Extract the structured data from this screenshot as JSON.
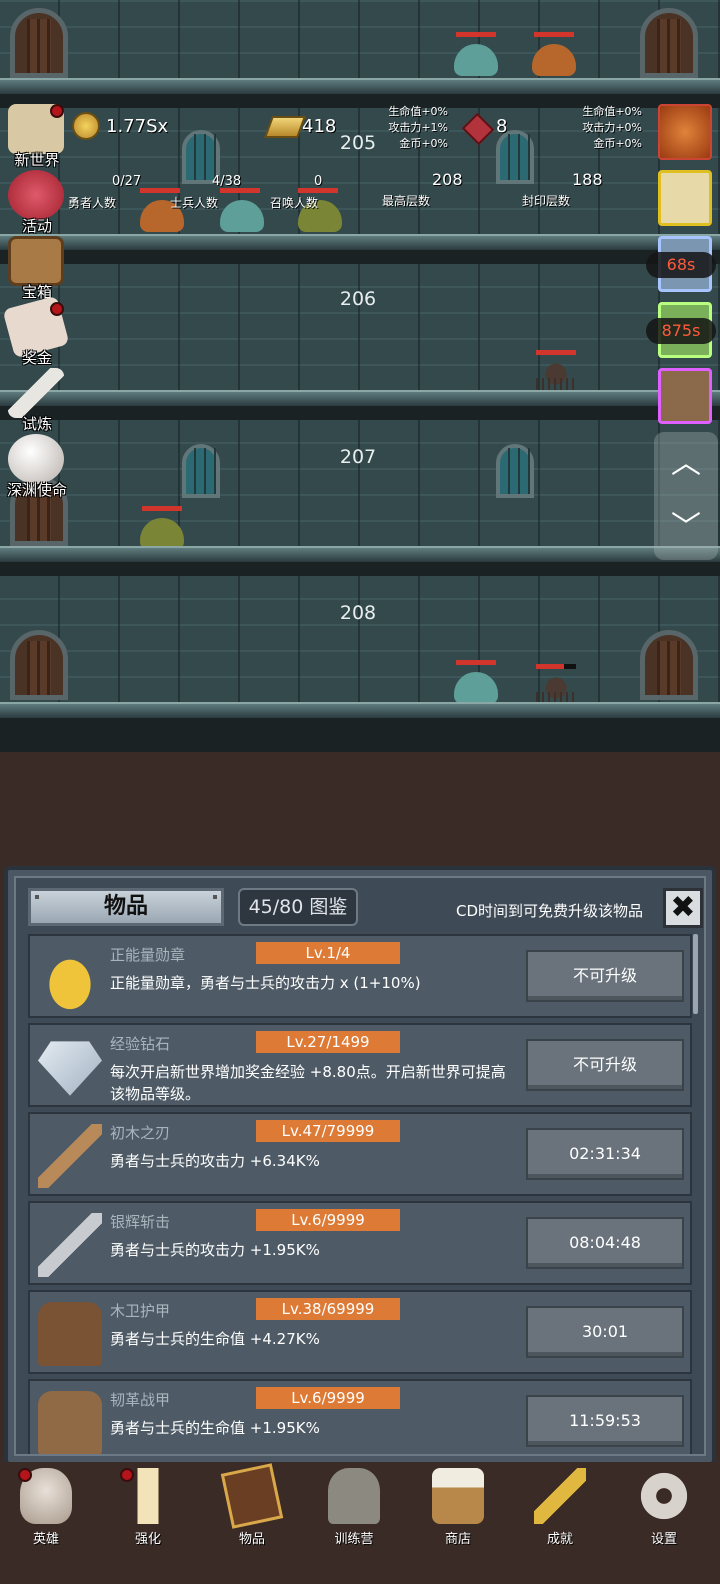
{
  "scene": {
    "floors": [
      "205",
      "206",
      "207",
      "208"
    ]
  },
  "left_menu": [
    {
      "label": "新世界",
      "badge": true
    },
    {
      "label": "活动",
      "badge": false
    },
    {
      "label": "宝箱",
      "badge": false
    },
    {
      "label": "奖金",
      "badge": true
    },
    {
      "label": "试炼",
      "badge": false
    },
    {
      "label": "深渊使命",
      "badge": false
    }
  ],
  "resources": {
    "gold": "1.77Sx",
    "bars": "418",
    "gems": "8",
    "heroes": "0/27",
    "heroes_label": "勇者人数",
    "soldiers": "4/38",
    "soldiers_label": "士兵人数",
    "summons": "0",
    "summons_label": "召唤人数",
    "max_floor": "208",
    "max_floor_label": "最高层数",
    "sealed_floor": "188",
    "sealed_floor_label": "封印层数"
  },
  "buffs_a": {
    "hp": "生命值+0%",
    "atk": "攻击力+1%",
    "gold": "金币+0%"
  },
  "buffs_b": {
    "hp": "生命值+0%",
    "atk": "攻击力+0%",
    "gold": "金币+0%"
  },
  "right_timers": {
    "t1": "68s",
    "t2": "875s"
  },
  "scroll": {
    "up": "︿",
    "down": "﹀"
  },
  "panel": {
    "tab": "物品",
    "count": "45/80 图鉴",
    "cd_note": "CD时间到可免费升级该物品",
    "close": "✖",
    "items": [
      {
        "name": "正能量勋章",
        "level": "Lv.1/4",
        "desc": "正能量勋章，勇者与士兵的攻击力 x (1+10%)",
        "action": "不可升级"
      },
      {
        "name": "经验钻石",
        "level": "Lv.27/1499",
        "desc": "每次开启新世界增加奖金经验 +8.80点。开启新世界可提高该物品等级。",
        "action": "不可升级"
      },
      {
        "name": "初木之刃",
        "level": "Lv.47/79999",
        "desc": "勇者与士兵的攻击力 +6.34K%",
        "action": "02:31:34"
      },
      {
        "name": "银辉斩击",
        "level": "Lv.6/9999",
        "desc": "勇者与士兵的攻击力 +1.95K%",
        "action": "08:04:48"
      },
      {
        "name": "木卫护甲",
        "level": "Lv.38/69999",
        "desc": "勇者与士兵的生命值 +4.27K%",
        "action": "30:01"
      },
      {
        "name": "韧革战甲",
        "level": "Lv.6/9999",
        "desc": "勇者与士兵的生命值 +1.95K%",
        "action": "11:59:53"
      }
    ]
  },
  "nav": [
    {
      "label": "英雄",
      "badge": true
    },
    {
      "label": "强化",
      "badge": true
    },
    {
      "label": "物品",
      "badge": false
    },
    {
      "label": "训练营",
      "badge": false
    },
    {
      "label": "商店",
      "badge": false
    },
    {
      "label": "成就",
      "badge": false
    },
    {
      "label": "设置",
      "badge": false
    }
  ]
}
